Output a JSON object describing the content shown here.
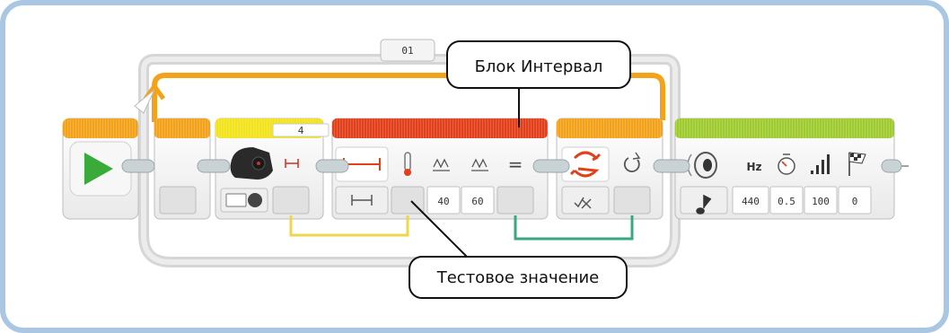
{
  "loop": {
    "label": "01",
    "count_label": "4"
  },
  "callouts": {
    "range_block": "Блок Интервал",
    "test_value": "Тестовое значение"
  },
  "range_block": {
    "lower_value": "40",
    "upper_value": "60",
    "equals_symbol": "="
  },
  "sound_block": {
    "hz_label": "Hz",
    "frequency": "440",
    "duration": "0.5",
    "volume": "100",
    "play_type": "0"
  },
  "colors": {
    "loop_orange": "#f3a21a",
    "sensor_yellow": "#f2e31c",
    "range_red": "#e2401b",
    "switch_orange": "#f3a21a",
    "action_green": "#9fcb30",
    "start_green": "#3aab3a",
    "wire_yellow": "#eed64f",
    "wire_green": "#3aa780",
    "frame_blue": "#a9c7e3"
  },
  "icons": [
    "start-play-icon",
    "motor-sensor-icon",
    "range-outside-icon",
    "range-inside-icon",
    "test-thermometer-icon",
    "lower-bound-icon",
    "upper-bound-icon",
    "compare-switch-icon",
    "loop-repeat-icon",
    "true-false-icon",
    "speaker-icon",
    "note-icon",
    "timer-icon",
    "volume-bars-icon",
    "finish-flag-icon"
  ]
}
